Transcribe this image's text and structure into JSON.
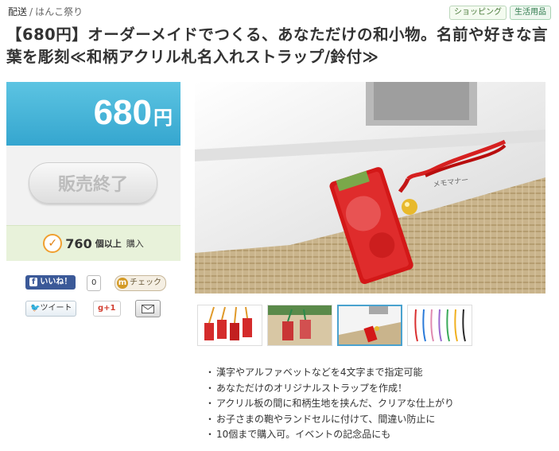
{
  "breadcrumb": {
    "item1": "配送",
    "sep": "/",
    "item2": "はんこ祭り"
  },
  "tags": [
    "ショッピング",
    "生活用品"
  ],
  "title": "【680円】オーダーメイドでつくる、あなただけの和小物。名前や好きな言葉を彫刻≪和柄アクリル札名入れストラップ/鈴付≫",
  "price": {
    "amount": "680",
    "unit": "円"
  },
  "status_button": "販売終了",
  "purchase": {
    "count": "760",
    "unit": "個以上",
    "label": "購入"
  },
  "social": {
    "facebook_like": "いいね！",
    "facebook_count": "0",
    "mixi_check": "チェック",
    "tweet": "ツイート",
    "gplus": "g+1"
  },
  "features": [
    "漢字やアルファベットなどを4文字まで指定可能",
    "あなただけのオリジナルストラップを作成！",
    "アクリル板の間に和柄生地を挟んだ、クリアな仕上がり",
    "お子さまの鞄やランドセルに付けて、間違い防止に",
    "10個まで購入可。イベントの記念品にも"
  ],
  "photo_text": "メモマナー",
  "colors": {
    "price_bg": "#3fb0d8",
    "buy_bg": "#e8f2da",
    "active_thumb": "#4aa2cf"
  }
}
